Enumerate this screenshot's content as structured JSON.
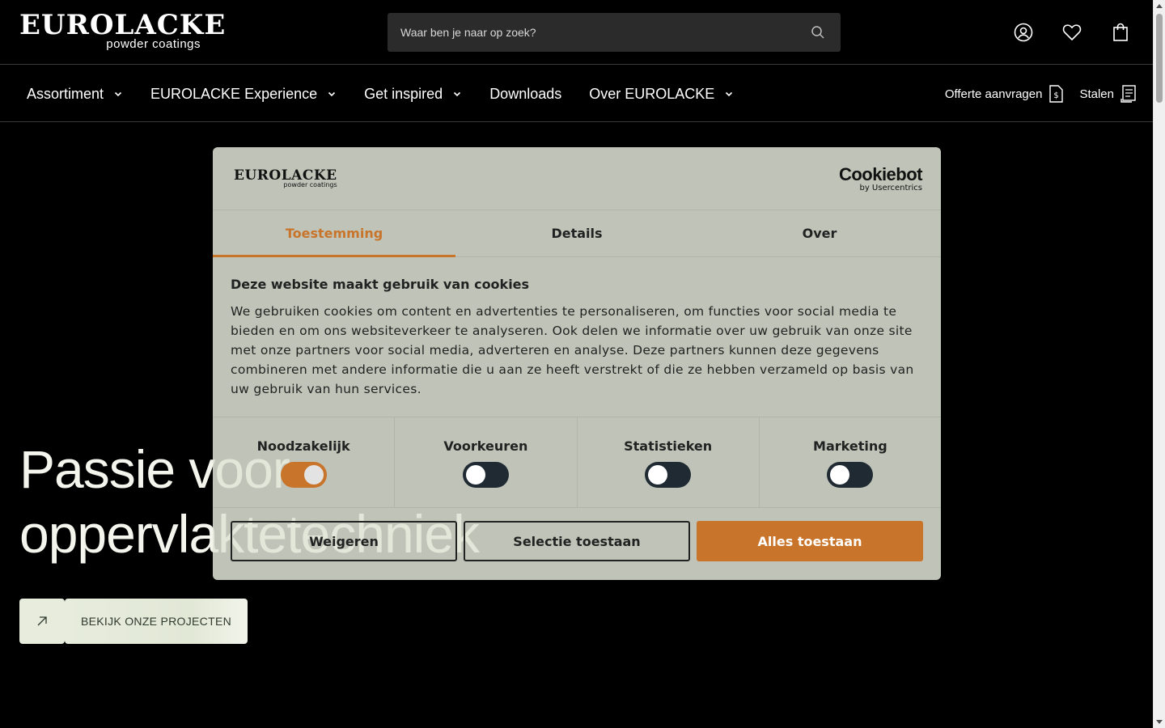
{
  "header": {
    "logo_main": "EUROLACKE",
    "logo_sub": "powder coatings",
    "search_placeholder": "Waar ben je naar op zoek?",
    "icons": [
      "account-icon",
      "heart-icon",
      "cart-icon"
    ]
  },
  "nav": {
    "items": [
      {
        "label": "Assortiment",
        "dropdown": true
      },
      {
        "label": "EUROLACKE Experience",
        "dropdown": true
      },
      {
        "label": "Get inspired",
        "dropdown": true
      },
      {
        "label": "Downloads",
        "dropdown": false
      },
      {
        "label": "Over EUROLACKE",
        "dropdown": true
      }
    ],
    "right": [
      {
        "label": "Offerte aanvragen",
        "icon": "quote-icon"
      },
      {
        "label": "Stalen",
        "icon": "samples-icon"
      }
    ]
  },
  "hero": {
    "title_line1": "Passie voor",
    "title_line2": "oppervlaktetechniek",
    "button_label": "BEKIJK ONZE PROJECTEN"
  },
  "cookie": {
    "logo_main": "EUROLACKE",
    "logo_sub": "powder coatings",
    "brand_main": "Cookiebot",
    "brand_sub": "by Usercentrics",
    "tabs": [
      {
        "label": "Toestemming",
        "active": true
      },
      {
        "label": "Details",
        "active": false
      },
      {
        "label": "Over",
        "active": false
      }
    ],
    "heading": "Deze website maakt gebruik van cookies",
    "body": "We gebruiken cookies om content en advertenties te personaliseren, om functies voor social media te bieden en om ons websiteverkeer te analyseren. Ook delen we informatie over uw gebruik van onze site met onze partners voor social media, adverteren en analyse. Deze partners kunnen deze gegevens combineren met andere informatie die u aan ze heeft verstrekt of die ze hebben verzameld op basis van uw gebruik van hun services.",
    "toggles": [
      {
        "label": "Noodzakelijk",
        "on": true
      },
      {
        "label": "Voorkeuren",
        "on": false
      },
      {
        "label": "Statistieken",
        "on": false
      },
      {
        "label": "Marketing",
        "on": false
      }
    ],
    "buttons": {
      "reject": "Weigeren",
      "selection": "Selectie toestaan",
      "accept_all": "Alles toestaan"
    }
  },
  "colors": {
    "accent": "#c8742a",
    "background": "#000000",
    "dialog": "#dfe4d6"
  }
}
